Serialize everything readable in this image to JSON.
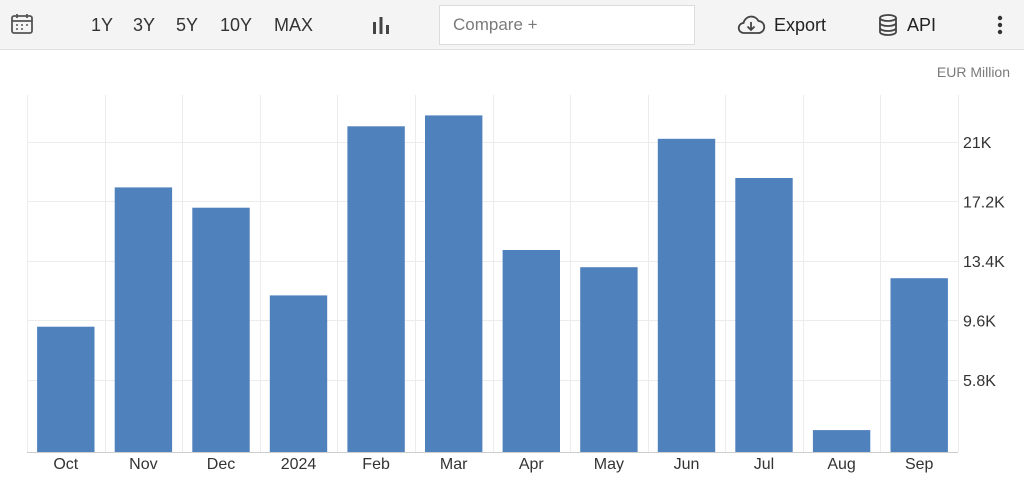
{
  "toolbar": {
    "calendar_icon": "calendar-icon",
    "ranges": [
      "1Y",
      "3Y",
      "5Y",
      "10Y",
      "MAX"
    ],
    "chart_type_icon": "bar-chart-icon",
    "compare_placeholder": "Compare +",
    "export_label": "Export",
    "export_icon": "cloud-download-icon",
    "api_label": "API",
    "api_icon": "database-icon",
    "more_icon": "vertical-ellipsis-icon"
  },
  "chart_data": {
    "type": "bar",
    "unit_label": "EUR Million",
    "categories": [
      "Oct",
      "Nov",
      "Dec",
      "2024",
      "Feb",
      "Mar",
      "Apr",
      "May",
      "Jun",
      "Jul",
      "Aug",
      "Sep"
    ],
    "values": [
      9.2,
      18.1,
      16.8,
      11.2,
      22.0,
      22.7,
      14.1,
      13.0,
      21.2,
      18.7,
      2.6,
      12.3
    ],
    "value_scale": "thousands",
    "y_ticks": [
      "5.8K",
      "9.6K",
      "13.4K",
      "17.2K",
      "21K"
    ],
    "y_tick_values": [
      5.8,
      9.6,
      13.4,
      17.2,
      21.0
    ],
    "ylim": [
      1.2,
      24.0
    ],
    "y_axis_side": "right",
    "grid": true,
    "bar_color": "#4f81bd",
    "grid_color": "#ececec"
  }
}
